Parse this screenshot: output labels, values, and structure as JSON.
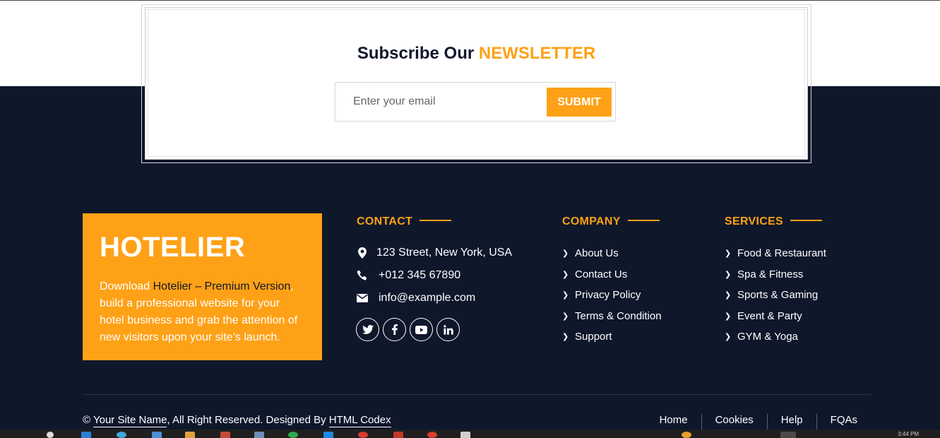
{
  "newsletter": {
    "title_prefix": "Subscribe Our",
    "title_accent": "NEWSLETTER",
    "email_placeholder": "Enter your email",
    "submit_label": "SUBMIT"
  },
  "brand": {
    "name": "HOTELIER",
    "text_before": "Download ",
    "link_text": "Hotelier – Premium Version",
    "text_after": ", build a professional website for your hotel business and grab the attention of new visitors upon your site’s launch."
  },
  "contact": {
    "title": "CONTACT",
    "address": "123 Street, New York, USA",
    "phone": "+012 345 67890",
    "email": "info@example.com",
    "socials": [
      "twitter-icon",
      "facebook-icon",
      "youtube-icon",
      "linkedin-icon"
    ]
  },
  "company": {
    "title": "COMPANY",
    "items": [
      "About Us",
      "Contact Us",
      "Privacy Policy",
      "Terms & Condition",
      "Support"
    ]
  },
  "services": {
    "title": "SERVICES",
    "items": [
      "Food & Restaurant",
      "Spa & Fitness",
      "Sports & Gaming",
      "Event & Party",
      "GYM & Yoga"
    ]
  },
  "footer": {
    "copyright_symbol": "©",
    "site_name": "Your Site Name",
    "rights": ", All Right Reserved. Designed By ",
    "designer": "HTML Codex",
    "menu": [
      "Home",
      "Cookies",
      "Help",
      "FQAs"
    ]
  },
  "taskbar": {
    "clock": "3:44 PM"
  },
  "colors": {
    "accent": "#fea116",
    "dark": "#0f172b",
    "white": "#ffffff"
  }
}
